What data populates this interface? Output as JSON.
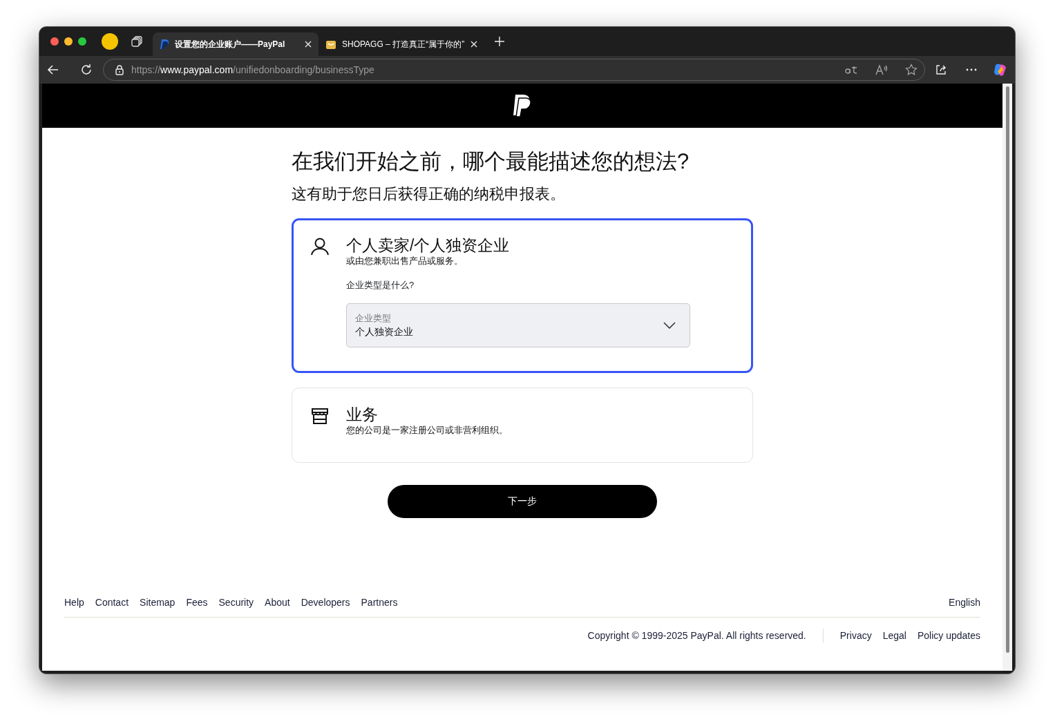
{
  "browser": {
    "tabs": [
      {
        "title": "设置您的企业账户——PayPal",
        "kind": "paypal",
        "selected": true
      },
      {
        "title": "SHOPAGG – 打造真正“属于你的”",
        "kind": "shop",
        "selected": false
      }
    ],
    "address": {
      "scheme": "https://",
      "host": "www.paypal.com",
      "path": "/unifiedonboarding/businessType"
    }
  },
  "page": {
    "heading": "在我们开始之前，哪个最能描述您的想法?",
    "subheading": "这有助于您日后获得正确的纳税申报表。",
    "options": [
      {
        "kind": "person",
        "title": "个人卖家/个人独资企业",
        "description": "或由您兼职出售产品或服务。",
        "selected": true,
        "question": "企业类型是什么?",
        "select": {
          "label": "企业类型",
          "value": "个人独资企业"
        }
      },
      {
        "kind": "store",
        "title": "业务",
        "description": "您的公司是一家注册公司或非营利组织。",
        "selected": false
      }
    ],
    "next_button": "下一步"
  },
  "footer": {
    "links": [
      "Help",
      "Contact",
      "Sitemap",
      "Fees",
      "Security",
      "About",
      "Developers",
      "Partners"
    ],
    "language": "English",
    "copyright": "Copyright © 1999-2025 PayPal. All rights reserved.",
    "legal_links": [
      "Privacy",
      "Legal",
      "Policy updates"
    ]
  }
}
